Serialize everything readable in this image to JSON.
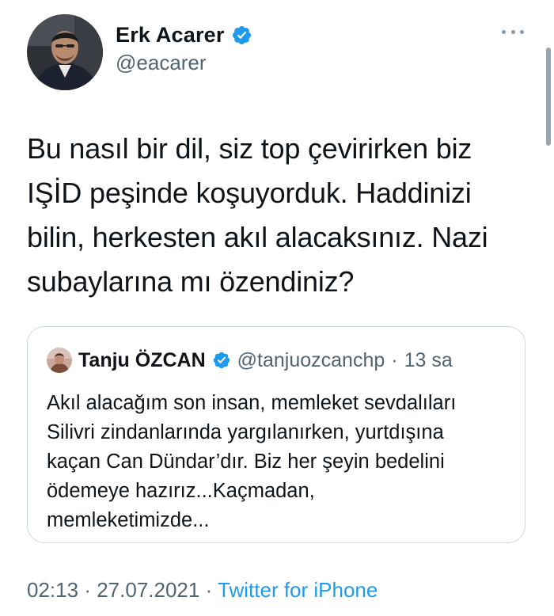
{
  "author": {
    "name": "Erk Acarer",
    "handle": "@eacarer",
    "verified": true
  },
  "tweet": {
    "text": "Bu nasıl bir dil, siz top çevirirken biz\nIŞİD peşinde koşuyorduk. Haddinizi\nbilin, herkesten akıl alacaksınız. Nazi\nsubaylarına mı özendiniz?"
  },
  "quoted_tweet": {
    "name": "Tanju ÖZCAN",
    "handle": "@tanjuozcanchp",
    "separator": "·",
    "time": "13 sa",
    "verified": true,
    "text": "Akıl alacağım son insan, memleket sevdalıları\nSilivri zindanlarında yargılanırken, yurtdışına\nkaçan Can Dündar’dır. Biz her şeyin bedelini\nödemeye hazırız...Kaçmadan,\nmemleketimizde..."
  },
  "meta": {
    "time": "02:13",
    "separator": "·",
    "date": "27.07.2021",
    "source": "Twitter for iPhone"
  },
  "colors": {
    "text": "#0f1419",
    "secondary": "#536471",
    "accent": "#1d9bf0",
    "border": "#cfd9de"
  },
  "icons": {
    "verified": "verified-badge-icon",
    "more": "more-horizontal-icon"
  }
}
